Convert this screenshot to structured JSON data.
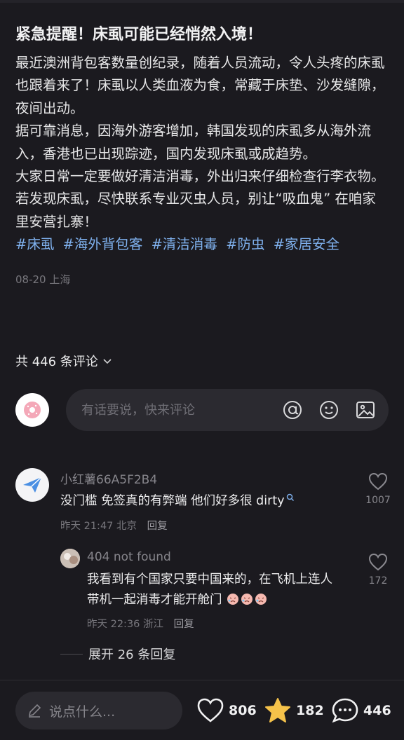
{
  "post": {
    "title": "紧急提醒！床虱可能已经悄然入境！",
    "paragraphs": [
      "最近澳洲背包客数量创纪录，随着人员流动，令人头疼的床虱也跟着来了！床虱以人类血液为食，常藏于床垫、沙发缝隙，夜间出动。",
      "据可靠消息，因海外游客增加，韩国发现的床虱多从海外流入，香港也已出现踪迹，国内发现床虱或成趋势。",
      "大家日常一定要做好清洁消毒，外出归来仔细检查行李衣物。若发现床虱，尽快联系专业灭虫人员，别让“吸血鬼” 在咱家里安营扎寨！"
    ],
    "tags": [
      "#床虱",
      "#海外背包客",
      "#清洁消毒",
      "#防虫",
      "#家居安全"
    ],
    "date": "08-20",
    "location": "上海"
  },
  "comments_header": {
    "label": "共 446 条评论"
  },
  "composer": {
    "placeholder": "有话要说，快来评论"
  },
  "comments": [
    {
      "name": "小红薯66A5F2B4",
      "text": "没门槛 免签真的有弊端 他们好多很 dirty",
      "time": "昨天 21:47",
      "location": "北京",
      "reply_label": "回复",
      "likes": "1007"
    },
    {
      "name": "404 not found",
      "text": "我看到有个国家只要中国来的，在飞机上连人带机一起消毒才能开舱门",
      "time": "昨天 22:36",
      "location": "浙江",
      "reply_label": "回复",
      "likes": "172"
    }
  ],
  "expand": {
    "label": "展开 26 条回复"
  },
  "bottom_bar": {
    "say_placeholder": "说点什么...",
    "likes": "806",
    "stars": "182",
    "comments": "446"
  },
  "colors": {
    "background": "#1b1a1f",
    "tag": "#7fb1ee",
    "star": "#f5c24a"
  }
}
